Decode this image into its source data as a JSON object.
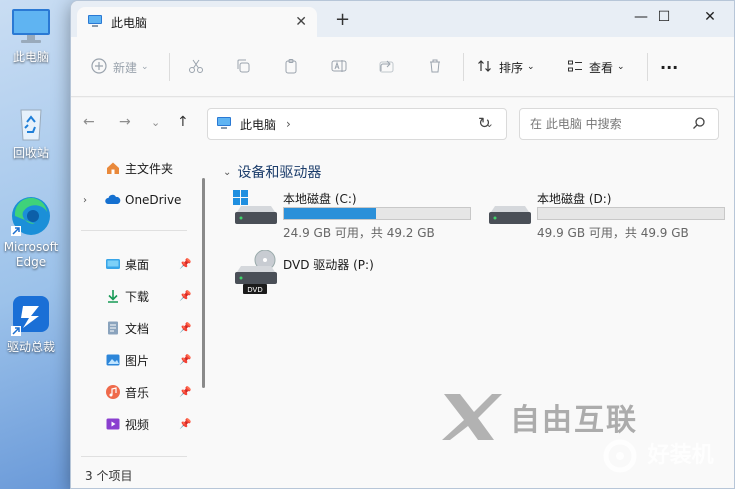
{
  "desktop": {
    "icons": [
      {
        "label": "此电脑",
        "icon": "monitor-icon"
      },
      {
        "label": "回收站",
        "icon": "recycle-bin-icon"
      },
      {
        "label": "Microsoft Edge",
        "icon": "edge-icon"
      },
      {
        "label": "驱动总裁",
        "icon": "driver-app-icon"
      }
    ]
  },
  "window": {
    "tab_title": "此电脑",
    "new_tab": "+",
    "controls": {
      "minimize": "—",
      "maximize": "☐",
      "close": "✕"
    }
  },
  "toolbar": {
    "new_label": "新建",
    "sort_label": "排序",
    "view_label": "查看",
    "more": "···"
  },
  "nav": {
    "breadcrumb": [
      "此电脑"
    ],
    "search_placeholder": "在 此电脑 中搜索"
  },
  "sidebar": {
    "items": [
      {
        "label": "主文件夹",
        "icon": "home-icon"
      },
      {
        "label": "OneDrive",
        "icon": "onedrive-cloud-icon"
      },
      {
        "label": "桌面",
        "icon": "desktop-folder-icon"
      },
      {
        "label": "下载",
        "icon": "download-icon"
      },
      {
        "label": "文档",
        "icon": "documents-icon"
      },
      {
        "label": "图片",
        "icon": "pictures-icon"
      },
      {
        "label": "音乐",
        "icon": "music-icon"
      },
      {
        "label": "视频",
        "icon": "videos-icon"
      }
    ]
  },
  "main": {
    "group_header": "设备和驱动器",
    "drives": [
      {
        "name": "本地磁盘 (C:)",
        "info": "24.9 GB 可用，共 49.2 GB",
        "used_fraction": 0.494
      },
      {
        "name": "本地磁盘 (D:)",
        "info": "49.9 GB 可用，共 49.9 GB",
        "used_fraction": 0.0
      },
      {
        "name": "DVD 驱动器 (P:)",
        "badge": "DVD"
      }
    ]
  },
  "status": {
    "item_count": "3 个项目"
  },
  "watermark": {
    "text": "自由互联",
    "text2": "好装机"
  },
  "colors": {
    "accent": "#2b90d9",
    "folder_blue": "#1e73be"
  }
}
